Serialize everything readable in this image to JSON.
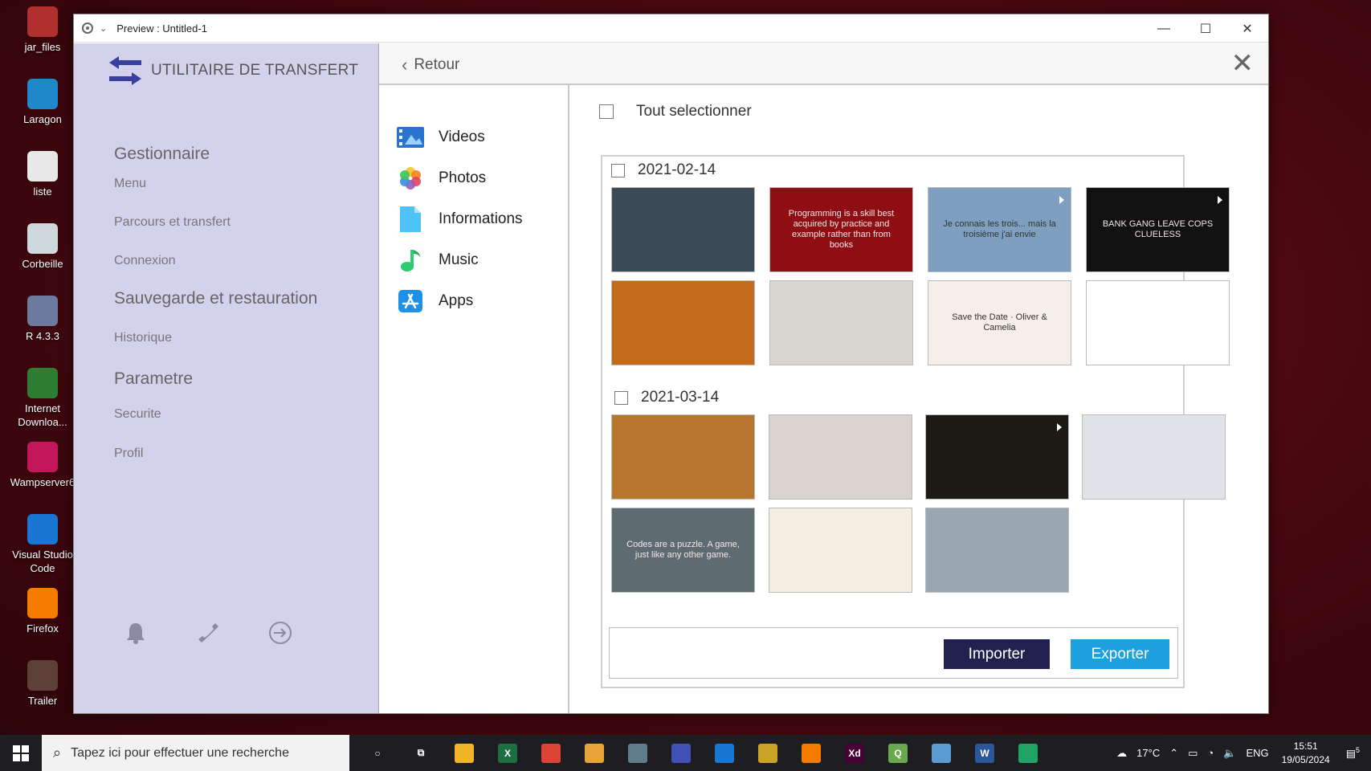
{
  "desktop": {
    "icons": [
      {
        "label": "jar_files",
        "icon": "winrar-icon",
        "color": "#b0302f"
      },
      {
        "label": "Laragon",
        "icon": "laragon-icon",
        "color": "#1e88c8"
      },
      {
        "label": "liste",
        "icon": "text-file-icon",
        "color": "#e8e8e8"
      },
      {
        "label": "Corbeille",
        "icon": "recycle-bin-icon",
        "color": "#cfd8dc"
      },
      {
        "label": "R 4.3.3",
        "icon": "r-icon",
        "color": "#6b7a9e"
      },
      {
        "label": "Internet Downloa...",
        "icon": "idm-icon",
        "color": "#2e7d32"
      },
      {
        "label": "Wampserver6",
        "icon": "wampserver-icon",
        "color": "#c2185b"
      },
      {
        "label": "Visual Studio Code",
        "icon": "vscode-icon",
        "color": "#1976d2"
      },
      {
        "label": "Firefox",
        "icon": "firefox-icon",
        "color": "#f57c00"
      },
      {
        "label": "Trailer",
        "icon": "video-file-icon",
        "color": "#5d4037"
      }
    ]
  },
  "window": {
    "title": "Preview : Untitled-1",
    "minimize": "—",
    "maximize": "☐",
    "close": "✕"
  },
  "sidebar": {
    "brand": "UTILITAIRE DE TRANSFERT",
    "sections": [
      {
        "heading": "Gestionnaire",
        "items": [
          "Menu",
          "Parcours et transfert",
          "Connexion"
        ]
      },
      {
        "heading": "Sauvegarde et restauration",
        "items": [
          "Historique"
        ]
      },
      {
        "heading": "Parametre",
        "items": [
          "Securite",
          "Profil"
        ]
      }
    ]
  },
  "header": {
    "back_label": "Retour",
    "close_glyph": "✕"
  },
  "categories": [
    {
      "label": "Videos",
      "icon": "video-icon"
    },
    {
      "label": "Photos",
      "icon": "photos-icon"
    },
    {
      "label": "Informations",
      "icon": "document-icon"
    },
    {
      "label": "Music",
      "icon": "music-icon"
    },
    {
      "label": "Apps",
      "icon": "app-store-icon"
    }
  ],
  "main": {
    "select_all_label": "Tout selectionner",
    "groups": [
      {
        "date": "2021-02-14",
        "thumbs": [
          {
            "kind": "car-photo",
            "bg": "#3b4a55",
            "caption": "",
            "video": false
          },
          {
            "kind": "quote-slide",
            "bg": "#8e0e14",
            "caption": "Programming is a skill best acquired by practice and example rather than from books",
            "video": false
          },
          {
            "kind": "anime-video",
            "bg": "#7f9fc0",
            "caption": "Je connais les trois... mais la troisième j'ai envie",
            "video": true
          },
          {
            "kind": "newspaper-video",
            "bg": "#111111",
            "caption": "BANK GANG LEAVE COPS CLUELESS",
            "video": true
          },
          {
            "kind": "vintage-car-photo",
            "bg": "#c46a1c",
            "caption": "",
            "video": false
          },
          {
            "kind": "portrait-photo",
            "bg": "#d9d6d1",
            "caption": "",
            "video": false
          },
          {
            "kind": "wedding-card",
            "bg": "#f6efe9",
            "caption": "Save the Date · Oliver & Camelia",
            "video": false
          },
          {
            "kind": "blank",
            "bg": "#ffffff",
            "caption": "",
            "video": false
          }
        ]
      },
      {
        "date": "2021-03-14",
        "thumbs": [
          {
            "kind": "roadster-photo",
            "bg": "#b8762f",
            "caption": "",
            "video": false
          },
          {
            "kind": "business-cards",
            "bg": "#d8d3cc",
            "caption": "",
            "video": false
          },
          {
            "kind": "dark-video",
            "bg": "#1b1a14",
            "caption": "",
            "video": true
          },
          {
            "kind": "scanner-photo",
            "bg": "#dfe3e7",
            "caption": "",
            "video": false
          },
          {
            "kind": "quote-photo",
            "bg": "#5f6b72",
            "caption": "Codes are a puzzle. A game, just like any other game.",
            "video": false
          },
          {
            "kind": "web-mockup",
            "bg": "#f4efe2",
            "caption": "",
            "video": false
          },
          {
            "kind": "typing-photo",
            "bg": "#9aa7b0",
            "caption": "",
            "video": false
          }
        ]
      }
    ],
    "import_label": "Importer",
    "export_label": "Exporter"
  },
  "taskbar": {
    "search_placeholder": "Tapez ici pour effectuer une recherche",
    "apps": [
      {
        "icon": "cortana-icon",
        "color": "#1e1e22",
        "glyph": "○"
      },
      {
        "icon": "task-view-icon",
        "color": "#1e1e22",
        "glyph": "⧉"
      },
      {
        "icon": "file-explorer-icon",
        "color": "#f0b429",
        "glyph": ""
      },
      {
        "icon": "excel-icon",
        "color": "#1d6f42",
        "glyph": "X"
      },
      {
        "icon": "chrome-icon",
        "color": "#db4437",
        "glyph": ""
      },
      {
        "icon": "app-icon",
        "color": "#e8a33a",
        "glyph": ""
      },
      {
        "icon": "app-icon",
        "color": "#607d8b",
        "glyph": ""
      },
      {
        "icon": "app-icon",
        "color": "#3f51b5",
        "glyph": ""
      },
      {
        "icon": "vscode-icon",
        "color": "#1976d2",
        "glyph": ""
      },
      {
        "icon": "app-icon",
        "color": "#c9a227",
        "glyph": ""
      },
      {
        "icon": "firefox-icon",
        "color": "#f57c00",
        "glyph": ""
      },
      {
        "icon": "adobe-xd-icon",
        "color": "#470137",
        "glyph": "Xd"
      },
      {
        "icon": "qgis-icon",
        "color": "#6aa84f",
        "glyph": "Q"
      },
      {
        "icon": "app-icon",
        "color": "#5c9bd1",
        "glyph": ""
      },
      {
        "icon": "word-icon",
        "color": "#2b579a",
        "glyph": "W"
      },
      {
        "icon": "app-icon",
        "color": "#21a366",
        "glyph": ""
      }
    ],
    "weather": "17°C",
    "language": "ENG",
    "time": "15:51",
    "date": "19/05/2024",
    "notifications": "5"
  },
  "colors": {
    "sidebar_bg": "#d4d1ec",
    "import_btn": "#22204f",
    "export_btn": "#1d9fe0"
  }
}
